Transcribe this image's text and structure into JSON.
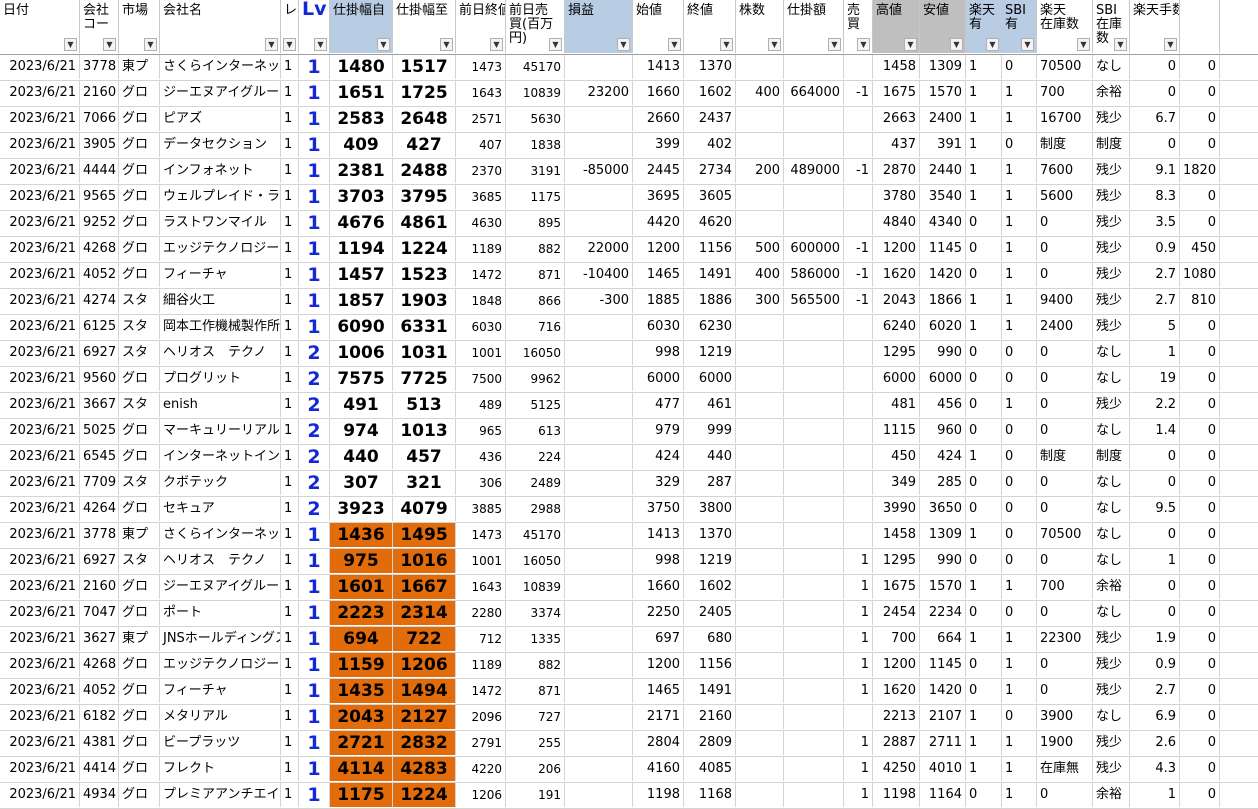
{
  "columns": [
    {
      "label": "日付",
      "bg": "#ffffff"
    },
    {
      "label": "会社\nコー",
      "bg": "#ffffff"
    },
    {
      "label": "市場",
      "bg": "#ffffff"
    },
    {
      "label": "会社名",
      "bg": "#ffffff"
    },
    {
      "label": "レ",
      "bg": "#ffffff"
    },
    {
      "label": "Lv",
      "bg": "#ffffff",
      "strong": true
    },
    {
      "label": "仕掛幅自",
      "bg": "#b8cce4"
    },
    {
      "label": "仕掛幅至",
      "bg": "#ffffff"
    },
    {
      "label": "前日終値",
      "bg": "#ffffff"
    },
    {
      "label": "前日売\n買(百万\n円)",
      "bg": "#ffffff"
    },
    {
      "label": "損益",
      "bg": "#b8cce4"
    },
    {
      "label": "始値",
      "bg": "#ffffff"
    },
    {
      "label": "終値",
      "bg": "#ffffff"
    },
    {
      "label": "株数",
      "bg": "#ffffff"
    },
    {
      "label": "仕掛額",
      "bg": "#ffffff"
    },
    {
      "label": "売\n買",
      "bg": "#ffffff"
    },
    {
      "label": "高値",
      "bg": "#bfbfbf"
    },
    {
      "label": "安値",
      "bg": "#bfbfbf"
    },
    {
      "label": "楽天\n有",
      "bg": "#b8cce4"
    },
    {
      "label": "SBI\n有",
      "bg": "#b8cce4"
    },
    {
      "label": "楽天\n在庫数",
      "bg": "#ffffff"
    },
    {
      "label": "SBI\n在庫\n数",
      "bg": "#ffffff"
    },
    {
      "label": "楽天手数料",
      "bg": "#ffffff"
    },
    {
      "label": "",
      "bg": "#ffffff",
      "nodd": true
    }
  ],
  "highlight_color": "#e26b0a",
  "lv_color": "#1428d8",
  "rows": [
    {
      "hl": false,
      "cells": [
        "2023/6/21",
        "3778",
        "東プ",
        "さくらインターネット",
        "1",
        "1",
        "1480",
        "1517",
        "1473",
        "45170",
        "",
        "1413",
        "1370",
        "",
        "",
        "",
        "1458",
        "1309",
        "1",
        "0",
        "70500",
        "なし",
        "0",
        "0"
      ]
    },
    {
      "hl": false,
      "cells": [
        "2023/6/21",
        "2160",
        "グロ",
        "ジーエヌアイグループ",
        "1",
        "1",
        "1651",
        "1725",
        "1643",
        "10839",
        "23200",
        "1660",
        "1602",
        "400",
        "664000",
        "-1",
        "1675",
        "1570",
        "1",
        "1",
        "700",
        "余裕",
        "0",
        "0"
      ]
    },
    {
      "hl": false,
      "cells": [
        "2023/6/21",
        "7066",
        "グロ",
        "ピアズ",
        "1",
        "1",
        "2583",
        "2648",
        "2571",
        "5630",
        "",
        "2660",
        "2437",
        "",
        "",
        "",
        "2663",
        "2400",
        "1",
        "1",
        "16700",
        "残少",
        "6.7",
        "0"
      ]
    },
    {
      "hl": false,
      "cells": [
        "2023/6/21",
        "3905",
        "グロ",
        "データセクション",
        "1",
        "1",
        "409",
        "427",
        "407",
        "1838",
        "",
        "399",
        "402",
        "",
        "",
        "",
        "437",
        "391",
        "1",
        "0",
        "制度",
        "制度",
        "0",
        "0"
      ]
    },
    {
      "hl": false,
      "cells": [
        "2023/6/21",
        "4444",
        "グロ",
        "インフォネット",
        "1",
        "1",
        "2381",
        "2488",
        "2370",
        "3191",
        "-85000",
        "2445",
        "2734",
        "200",
        "489000",
        "-1",
        "2870",
        "2440",
        "1",
        "1",
        "7600",
        "残少",
        "9.1",
        "1820"
      ]
    },
    {
      "hl": false,
      "cells": [
        "2023/6/21",
        "9565",
        "グロ",
        "ウェルプレイド・ライゼスト",
        "1",
        "1",
        "3703",
        "3795",
        "3685",
        "1175",
        "",
        "3695",
        "3605",
        "",
        "",
        "",
        "3780",
        "3540",
        "1",
        "1",
        "5600",
        "残少",
        "8.3",
        "0"
      ]
    },
    {
      "hl": false,
      "cells": [
        "2023/6/21",
        "9252",
        "グロ",
        "ラストワンマイル",
        "1",
        "1",
        "4676",
        "4861",
        "4630",
        "895",
        "",
        "4420",
        "4620",
        "",
        "",
        "",
        "4840",
        "4340",
        "0",
        "1",
        "0",
        "残少",
        "3.5",
        "0"
      ]
    },
    {
      "hl": false,
      "cells": [
        "2023/6/21",
        "4268",
        "グロ",
        "エッジテクノロジー",
        "1",
        "1",
        "1194",
        "1224",
        "1189",
        "882",
        "22000",
        "1200",
        "1156",
        "500",
        "600000",
        "-1",
        "1200",
        "1145",
        "0",
        "1",
        "0",
        "残少",
        "0.9",
        "450"
      ]
    },
    {
      "hl": false,
      "cells": [
        "2023/6/21",
        "4052",
        "グロ",
        "フィーチャ",
        "1",
        "1",
        "1457",
        "1523",
        "1472",
        "871",
        "-10400",
        "1465",
        "1491",
        "400",
        "586000",
        "-1",
        "1620",
        "1420",
        "0",
        "1",
        "0",
        "残少",
        "2.7",
        "1080"
      ]
    },
    {
      "hl": false,
      "cells": [
        "2023/6/21",
        "4274",
        "スタ",
        "細谷火工",
        "1",
        "1",
        "1857",
        "1903",
        "1848",
        "866",
        "-300",
        "1885",
        "1886",
        "300",
        "565500",
        "-1",
        "2043",
        "1866",
        "1",
        "1",
        "9400",
        "残少",
        "2.7",
        "810"
      ]
    },
    {
      "hl": false,
      "cells": [
        "2023/6/21",
        "6125",
        "スタ",
        "岡本工作機械製作所",
        "1",
        "1",
        "6090",
        "6331",
        "6030",
        "716",
        "",
        "6030",
        "6230",
        "",
        "",
        "",
        "6240",
        "6020",
        "1",
        "1",
        "2400",
        "残少",
        "5",
        "0"
      ]
    },
    {
      "hl": false,
      "cells": [
        "2023/6/21",
        "6927",
        "スタ",
        "ヘリオス　テクノ　ホールディング",
        "1",
        "2",
        "1006",
        "1031",
        "1001",
        "16050",
        "",
        "998",
        "1219",
        "",
        "",
        "",
        "1295",
        "990",
        "0",
        "0",
        "0",
        "なし",
        "1",
        "0"
      ]
    },
    {
      "hl": false,
      "cells": [
        "2023/6/21",
        "9560",
        "グロ",
        "プログリット",
        "1",
        "2",
        "7575",
        "7725",
        "7500",
        "9962",
        "",
        "6000",
        "6000",
        "",
        "",
        "",
        "6000",
        "6000",
        "0",
        "0",
        "0",
        "なし",
        "19",
        "0"
      ]
    },
    {
      "hl": false,
      "cells": [
        "2023/6/21",
        "3667",
        "スタ",
        "enish",
        "1",
        "2",
        "491",
        "513",
        "489",
        "5125",
        "",
        "477",
        "461",
        "",
        "",
        "",
        "481",
        "456",
        "0",
        "1",
        "0",
        "残少",
        "2.2",
        "0"
      ]
    },
    {
      "hl": false,
      "cells": [
        "2023/6/21",
        "5025",
        "グロ",
        "マーキュリーリアルテックイノベーター",
        "1",
        "2",
        "974",
        "1013",
        "965",
        "613",
        "",
        "979",
        "999",
        "",
        "",
        "",
        "1115",
        "960",
        "0",
        "0",
        "0",
        "なし",
        "1.4",
        "0"
      ]
    },
    {
      "hl": false,
      "cells": [
        "2023/6/21",
        "6545",
        "グロ",
        "インターネットインフィニティー",
        "1",
        "2",
        "440",
        "457",
        "436",
        "224",
        "",
        "424",
        "440",
        "",
        "",
        "",
        "450",
        "424",
        "1",
        "0",
        "制度",
        "制度",
        "0",
        "0"
      ]
    },
    {
      "hl": false,
      "cells": [
        "2023/6/21",
        "7709",
        "スタ",
        "クボテック",
        "1",
        "2",
        "307",
        "321",
        "306",
        "2489",
        "",
        "329",
        "287",
        "",
        "",
        "",
        "349",
        "285",
        "0",
        "0",
        "0",
        "なし",
        "0",
        "0"
      ]
    },
    {
      "hl": false,
      "cells": [
        "2023/6/21",
        "4264",
        "グロ",
        "セキュア",
        "1",
        "2",
        "3923",
        "4079",
        "3885",
        "2988",
        "",
        "3750",
        "3800",
        "",
        "",
        "",
        "3990",
        "3650",
        "0",
        "0",
        "0",
        "なし",
        "9.5",
        "0"
      ]
    },
    {
      "hl": true,
      "cells": [
        "2023/6/21",
        "3778",
        "東プ",
        "さくらインターネット",
        "1",
        "1",
        "1436",
        "1495",
        "1473",
        "45170",
        "",
        "1413",
        "1370",
        "",
        "",
        "",
        "1458",
        "1309",
        "1",
        "0",
        "70500",
        "なし",
        "0",
        "0"
      ]
    },
    {
      "hl": true,
      "cells": [
        "2023/6/21",
        "6927",
        "スタ",
        "ヘリオス　テクノ　ホールディング",
        "1",
        "1",
        "975",
        "1016",
        "1001",
        "16050",
        "",
        "998",
        "1219",
        "",
        "",
        "1",
        "1295",
        "990",
        "0",
        "0",
        "0",
        "なし",
        "1",
        "0"
      ]
    },
    {
      "hl": true,
      "cells": [
        "2023/6/21",
        "2160",
        "グロ",
        "ジーエヌアイグループ",
        "1",
        "1",
        "1601",
        "1667",
        "1643",
        "10839",
        "",
        "1660",
        "1602",
        "",
        "",
        "1",
        "1675",
        "1570",
        "1",
        "1",
        "700",
        "余裕",
        "0",
        "0"
      ]
    },
    {
      "hl": true,
      "cells": [
        "2023/6/21",
        "7047",
        "グロ",
        "ポート",
        "1",
        "1",
        "2223",
        "2314",
        "2280",
        "3374",
        "",
        "2250",
        "2405",
        "",
        "",
        "1",
        "2454",
        "2234",
        "0",
        "0",
        "0",
        "なし",
        "0",
        "0"
      ]
    },
    {
      "hl": true,
      "cells": [
        "2023/6/21",
        "3627",
        "東プ",
        "JNSホールディングス",
        "1",
        "1",
        "694",
        "722",
        "712",
        "1335",
        "",
        "697",
        "680",
        "",
        "",
        "1",
        "700",
        "664",
        "1",
        "1",
        "22300",
        "残少",
        "1.9",
        "0"
      ]
    },
    {
      "hl": true,
      "cells": [
        "2023/6/21",
        "4268",
        "グロ",
        "エッジテクノロジー",
        "1",
        "1",
        "1159",
        "1206",
        "1189",
        "882",
        "",
        "1200",
        "1156",
        "",
        "",
        "1",
        "1200",
        "1145",
        "0",
        "1",
        "0",
        "残少",
        "0.9",
        "0"
      ]
    },
    {
      "hl": true,
      "cells": [
        "2023/6/21",
        "4052",
        "グロ",
        "フィーチャ",
        "1",
        "1",
        "1435",
        "1494",
        "1472",
        "871",
        "",
        "1465",
        "1491",
        "",
        "",
        "1",
        "1620",
        "1420",
        "0",
        "1",
        "0",
        "残少",
        "2.7",
        "0"
      ]
    },
    {
      "hl": true,
      "cells": [
        "2023/6/21",
        "6182",
        "グロ",
        "メタリアル",
        "1",
        "1",
        "2043",
        "2127",
        "2096",
        "727",
        "",
        "2171",
        "2160",
        "",
        "",
        "",
        "2213",
        "2107",
        "1",
        "0",
        "3900",
        "なし",
        "6.9",
        "0"
      ]
    },
    {
      "hl": true,
      "cells": [
        "2023/6/21",
        "4381",
        "グロ",
        "ビープラッツ",
        "1",
        "1",
        "2721",
        "2832",
        "2791",
        "255",
        "",
        "2804",
        "2809",
        "",
        "",
        "1",
        "2887",
        "2711",
        "1",
        "1",
        "1900",
        "残少",
        "2.6",
        "0"
      ]
    },
    {
      "hl": true,
      "cells": [
        "2023/6/21",
        "4414",
        "グロ",
        "フレクト",
        "1",
        "1",
        "4114",
        "4283",
        "4220",
        "206",
        "",
        "4160",
        "4085",
        "",
        "",
        "1",
        "4250",
        "4010",
        "1",
        "1",
        "在庫無",
        "残少",
        "4.3",
        "0"
      ]
    },
    {
      "hl": true,
      "cells": [
        "2023/6/21",
        "4934",
        "グロ",
        "プレミアアンチエイジング",
        "1",
        "1",
        "1175",
        "1224",
        "1206",
        "191",
        "",
        "1198",
        "1168",
        "",
        "",
        "1",
        "1198",
        "1164",
        "0",
        "1",
        "0",
        "余裕",
        "1",
        "0"
      ]
    }
  ]
}
